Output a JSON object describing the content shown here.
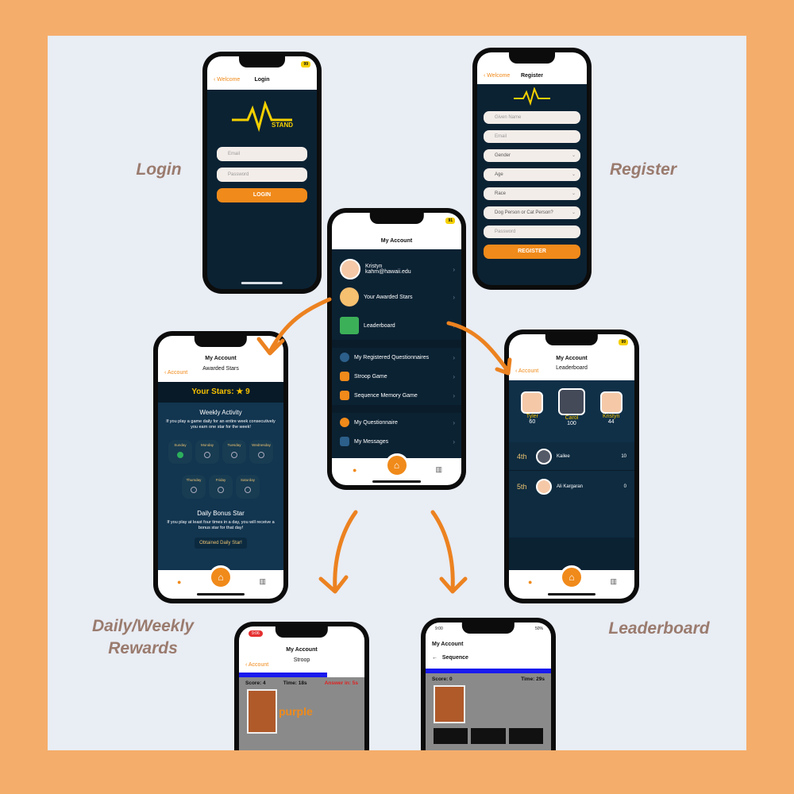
{
  "colors": {
    "outer_bg": "#f5ad6b",
    "panel_bg": "#e9edf4",
    "accent": "#f08a1a",
    "screen_bg": "#0b2233",
    "caption": "#9a7b6e"
  },
  "captions": {
    "login": "Login",
    "register": "Register",
    "rewards_line1": "Daily/Weekly",
    "rewards_line2": "Rewards",
    "leaderboard": "Leaderboard"
  },
  "login_screen": {
    "back": "Welcome",
    "title": "Login",
    "badge": "99",
    "logo_text": "STAND",
    "email_placeholder": "Email",
    "password_placeholder": "Password",
    "button": "LOGIN"
  },
  "register_screen": {
    "back": "Welcome",
    "title": "Register",
    "logo_text": "STAND",
    "fields": [
      "Given Name",
      "Email",
      "Gender",
      "Age",
      "Race",
      "Dog Person or Cat Person?",
      "Password"
    ],
    "button": "REGISTER"
  },
  "account_screen": {
    "title": "My Account",
    "badge": "91",
    "user_name": "Kristyn",
    "user_email": "kahm@hawaii.edu",
    "items": [
      "Your Awarded Stars",
      "Leaderboard",
      "My Registered Questionnaires",
      "Stroop Game",
      "Sequence Memory Game",
      "My Questionnaire",
      "My Messages"
    ]
  },
  "stars_screen": {
    "header": "My Account",
    "back": "Account",
    "title": "Awarded Stars",
    "your_stars_label": "Your Stars:",
    "your_stars_value": "9",
    "weekly_title": "Weekly Activity",
    "weekly_text": "If you play a game daily for an entire week consecutively you earn one star for the week!",
    "days_row1": [
      "Sunday",
      "Monday",
      "Tuesday",
      "Wednesday"
    ],
    "days_row2": [
      "Thursday",
      "Friday",
      "Saturday"
    ],
    "bonus_title": "Daily Bonus Star",
    "bonus_text": "If you play at least four times in a day, you will receive a bonus star for that day!",
    "bonus_button": "Obtained Daily Star!"
  },
  "leaderboard_screen": {
    "header": "My Account",
    "badge": "99",
    "back": "Account",
    "title": "Leaderboard",
    "podium": [
      {
        "rank": "2",
        "name": "Tyler",
        "score": "60"
      },
      {
        "rank": "1",
        "name": "Carol",
        "score": "100"
      },
      {
        "rank": "3",
        "name": "Kristyn",
        "score": "44"
      }
    ],
    "rows": [
      {
        "place": "4th",
        "name": "Kailee",
        "score": "10"
      },
      {
        "place": "5th",
        "name": "Ali Kargaran",
        "score": "0"
      }
    ]
  },
  "stroop_screen": {
    "status_time": "9:06",
    "header": "My Account",
    "back": "Account",
    "title": "Stroop",
    "score": "Score: 4",
    "time": "Time: 18s",
    "answer": "Answer in: 5s",
    "word": "purple"
  },
  "sequence_screen": {
    "status_time": "9:00",
    "battery": "50%",
    "header": "My Account",
    "title": "Sequence",
    "score": "Score: 0",
    "time": "Time: 29s"
  }
}
